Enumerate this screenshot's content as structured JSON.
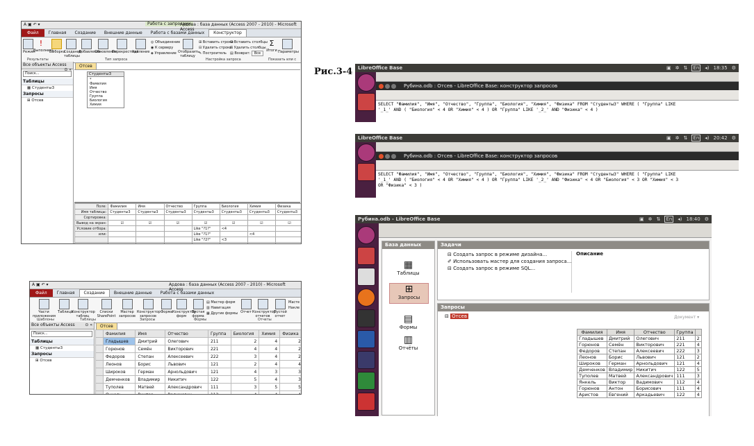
{
  "figure_label": "Рис.3-4",
  "access_design": {
    "title": "Ардова : база данных (Access 2007 - 2010) - Microsoft Access",
    "context_tab": "Работа с запросами",
    "tabs": [
      "Файл",
      "Главная",
      "Создание",
      "Внешние данные",
      "Работа с базами данных",
      "Конструктор"
    ],
    "ribbon_buttons": [
      "Режим",
      "Выполнить",
      "Выборка",
      "Создание таблицы",
      "Добавление",
      "Обновление",
      "Перекрестный",
      "Удаление",
      "Объединение",
      "К серверу",
      "Управление",
      "Отобразить таблицу",
      "Вставить строки",
      "Удалить строки",
      "Построитель",
      "Вставить столбцы",
      "Удалить столбцы",
      "Возврат:",
      "Все",
      "Итоги",
      "Параметры"
    ],
    "groups": [
      "Результаты",
      "Тип запроса",
      "Настройка запроса",
      "Показать или с"
    ],
    "nav_header": "Все объекты Access",
    "nav_search": "Поиск...",
    "nav_tables_group": "Таблицы",
    "nav_table_item": "Студенты3",
    "nav_queries_group": "Запросы",
    "nav_query_item": "Отсев",
    "doc_tab": "Отсев",
    "table_box_title": "Студенты3",
    "table_box_fields": [
      "*",
      "Фамилия",
      "Имя",
      "Отчество",
      "Группа",
      "Биология",
      "Химия"
    ],
    "grid_row_labels": [
      "Поле:",
      "Имя таблицы:",
      "Сортировка:",
      "Вывод на экран:",
      "Условие отбора:",
      "или:"
    ],
    "grid_columns": [
      {
        "field": "Фамилия",
        "table": "Студенты3",
        "criteria": [
          "",
          "",
          "",
          ""
        ]
      },
      {
        "field": "Имя",
        "table": "Студенты3",
        "criteria": [
          "",
          "",
          "",
          ""
        ]
      },
      {
        "field": "Отчество",
        "table": "Студенты3",
        "criteria": [
          "",
          "",
          "",
          ""
        ]
      },
      {
        "field": "Группа",
        "table": "Студенты3",
        "criteria": [
          "Like \"?1?\"",
          "Like \"?1?\"",
          "Like \"?2?\"",
          ""
        ]
      },
      {
        "field": "Биология",
        "table": "Студенты3",
        "criteria": [
          "<4",
          "",
          "<3",
          ""
        ]
      },
      {
        "field": "Химия",
        "table": "Студенты3",
        "criteria": [
          "",
          "<4",
          "",
          "<3"
        ]
      },
      {
        "field": "Физика",
        "table": "Студенты3",
        "criteria": [
          "",
          "",
          "",
          "<4"
        ]
      }
    ]
  },
  "access_result": {
    "title": "Ардова : база данных (Access 2007 - 2010) - Microsoft Access",
    "tabs": [
      "Файл",
      "Главная",
      "Создание",
      "Внешние данные",
      "Работа с базами данных"
    ],
    "ribbon_buttons": [
      "Части приложения",
      "Таблица",
      "Конструктор таблиц",
      "Списки SharePoint",
      "Мастер запросов",
      "Конструктор запросов",
      "Форма",
      "Конструктор форм",
      "Пустая форма",
      "Мастер форм",
      "Навигация",
      "Другие формы",
      "Отчет",
      "Конструктор отчетов",
      "Пустой отчет",
      "Масте",
      "Накле"
    ],
    "groups": [
      "Шаблоны",
      "Таблицы",
      "Запросы",
      "Формы",
      "Отчеты"
    ],
    "nav_header": "Все объекты Access",
    "nav_search": "Поиск...",
    "nav_tables_group": "Таблицы",
    "nav_table_item": "Студенты3",
    "nav_queries_group": "Запросы",
    "nav_query_item": "Отсев",
    "doc_tab": "Отсев",
    "columns": [
      "Фамилия",
      "Имя",
      "Отчество",
      "Группа",
      "Биология",
      "Химия",
      "Физика"
    ],
    "rows": [
      [
        "Гладышев",
        "Дмитрий",
        "Олегович",
        "211",
        "2",
        "4",
        "2"
      ],
      [
        "Горюнов",
        "Семён",
        "Викторович",
        "221",
        "4",
        "4",
        "2"
      ],
      [
        "Федоров",
        "Степан",
        "Алексеевич",
        "222",
        "3",
        "4",
        "2"
      ],
      [
        "Леонов",
        "Борис",
        "Львович",
        "121",
        "2",
        "4",
        "4"
      ],
      [
        "Широков",
        "Герман",
        "Арнольдович",
        "121",
        "4",
        "3",
        "3"
      ],
      [
        "Демченков",
        "Владимир",
        "Никитич",
        "122",
        "5",
        "4",
        "3"
      ],
      [
        "Туполев",
        "Матвей",
        "Александрович",
        "111",
        "3",
        "5",
        "5"
      ],
      [
        "Янкель",
        "Виктор",
        "Вадимович",
        "112",
        "4",
        "4",
        "4"
      ],
      [
        "Горюнов",
        "Антон",
        "Борисович",
        "111",
        "4",
        "4",
        "2"
      ],
      [
        "Аристов",
        "Евгений",
        "Аркадьевич",
        "122",
        "4",
        "3",
        "3"
      ]
    ]
  },
  "lo_sql1": {
    "app_title": "LibreOffice Base",
    "time": "18:35",
    "lang": "En",
    "window_title": "Рубина.odb : Отсев - LibreOffice Base: конструктор запросов",
    "sql": "SELECT \"Фамилия\", \"Имя\", \"Отчество\", \"Группа\", \"Биология\", \"Химия\", \"Физика\" FROM \"Студенты3\" WHERE ( \"Группа\" LIKE\n'_1_' AND ( \"Биология\" < 4 OR \"Химия\" < 4 ) OR \"Группа\" LIKE '_2_' AND \"Физика\" < 4 )"
  },
  "lo_sql2": {
    "app_title": "LibreOffice Base",
    "time": "20:42",
    "lang": "En",
    "window_title": "Рубина.odb : Отсев - LibreOffice Base: конструктор запросов",
    "sql": "SELECT \"Фамилия\", \"Имя\", \"Отчество\", \"Группа\", \"Биология\", \"Химия\", \"Физика\" FROM \"Студенты3\" WHERE ( \"Группа\" LIKE\n'_1_' AND ( \"Биология\" < 4 OR \"Химия\" < 4 ) OR \"Группа\" LIKE '_2_' AND \"Физика\" < 4 OR \"Биология\" < 3 OR \"Химия\" < 3\nOR \"Физика\" < 3 )"
  },
  "lo_base": {
    "app_title": "Рубина.odb - LibreOffice Base",
    "time": "18:40",
    "lang": "En",
    "db_panel": "База данных",
    "db_items": [
      "Таблицы",
      "Запросы",
      "Формы",
      "Отчёты"
    ],
    "tasks_panel": "Задачи",
    "tasks": [
      "Создать запрос в режиме дизайна...",
      "Использовать мастер для создания запроса...",
      "Создать запрос в режиме SQL..."
    ],
    "description_label": "Описание",
    "queries_panel": "Запросы",
    "query_item": "Отсев",
    "document_label": "Документ",
    "columns": [
      "Фамилия",
      "Имя",
      "Отчество",
      "Группа"
    ],
    "rows": [
      [
        "Гладышев",
        "Дмитрий",
        "Олегович",
        "211",
        "2"
      ],
      [
        "Горюнов",
        "Семён",
        "Викторович",
        "221",
        "4"
      ],
      [
        "Федоров",
        "Степан",
        "Алексеевич",
        "222",
        "3"
      ],
      [
        "Леонов",
        "Борис",
        "Львович",
        "121",
        "2"
      ],
      [
        "Широков",
        "Герман",
        "Арнольдович",
        "121",
        "4"
      ],
      [
        "Демченков",
        "Владимир",
        "Никитич",
        "122",
        "5"
      ],
      [
        "Туполев",
        "Матвей",
        "Александрович",
        "111",
        "3"
      ],
      [
        "Янкель",
        "Виктор",
        "Вадимович",
        "112",
        "4"
      ],
      [
        "Горюнов",
        "Антон",
        "Борисович",
        "111",
        "4"
      ],
      [
        "Аристов",
        "Евгений",
        "Аркадьевич",
        "122",
        "4"
      ]
    ]
  }
}
